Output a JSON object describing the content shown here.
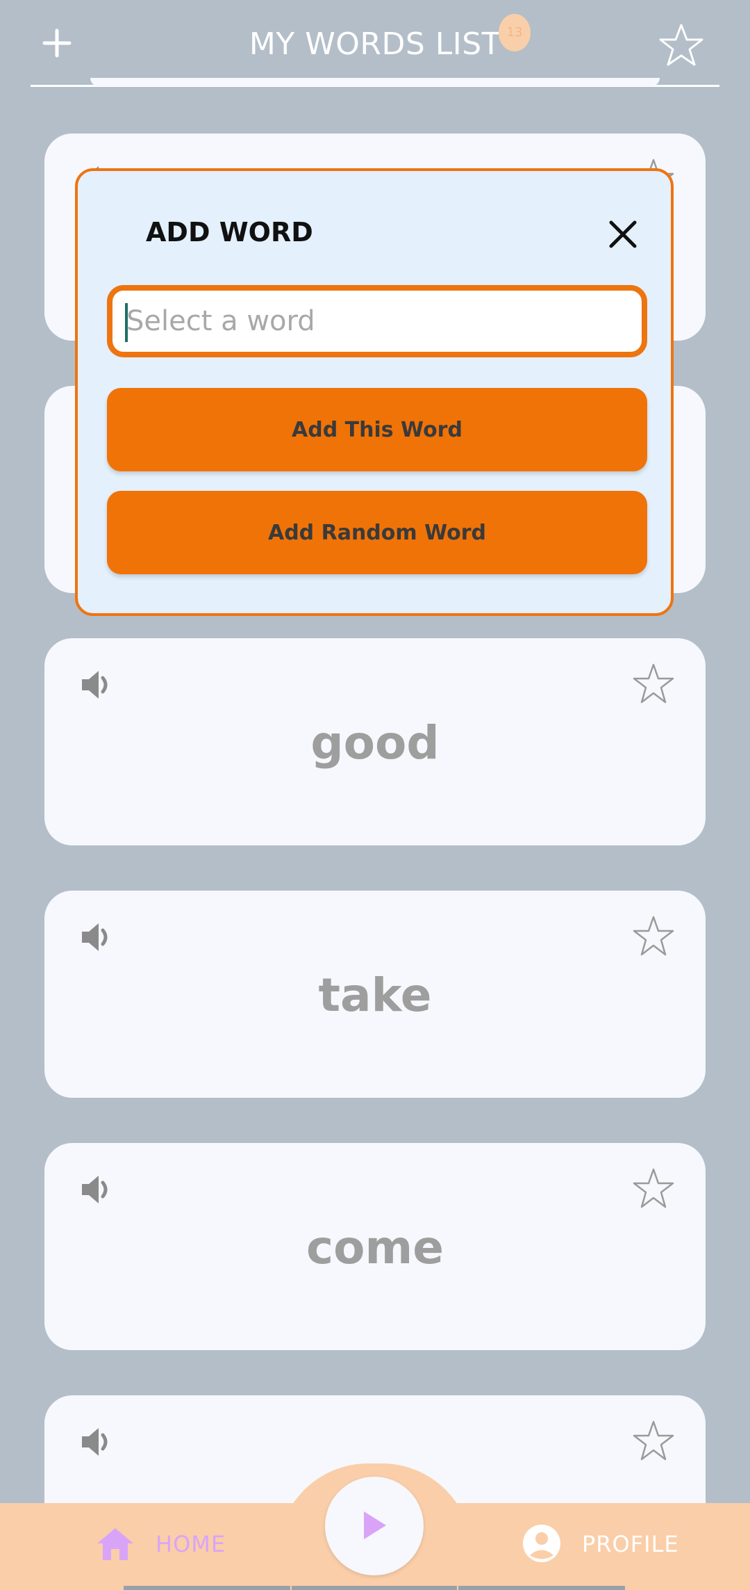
{
  "header": {
    "title": "MY WORDS LIST",
    "count_badge": "13"
  },
  "cards": [
    {
      "word": ""
    },
    {
      "word": ""
    },
    {
      "word": "good"
    },
    {
      "word": "take"
    },
    {
      "word": "come"
    },
    {
      "word": ""
    }
  ],
  "modal": {
    "title": "ADD WORD",
    "input_placeholder": "Select a word",
    "input_value": "",
    "add_button_label": "Add This Word",
    "random_button_label": "Add Random Word"
  },
  "nav": {
    "home_label": "HOME",
    "profile_label": "PROFILE"
  },
  "colors": {
    "background": "#b3bec8",
    "card": "#f6f8fd",
    "accent_orange": "#f07308",
    "nav_bar": "#facea8",
    "nav_purple": "#d9a4f8"
  },
  "icons": [
    "plus-icon",
    "star-icon",
    "speaker-icon",
    "close-icon",
    "play-icon",
    "home-icon",
    "profile-icon"
  ]
}
